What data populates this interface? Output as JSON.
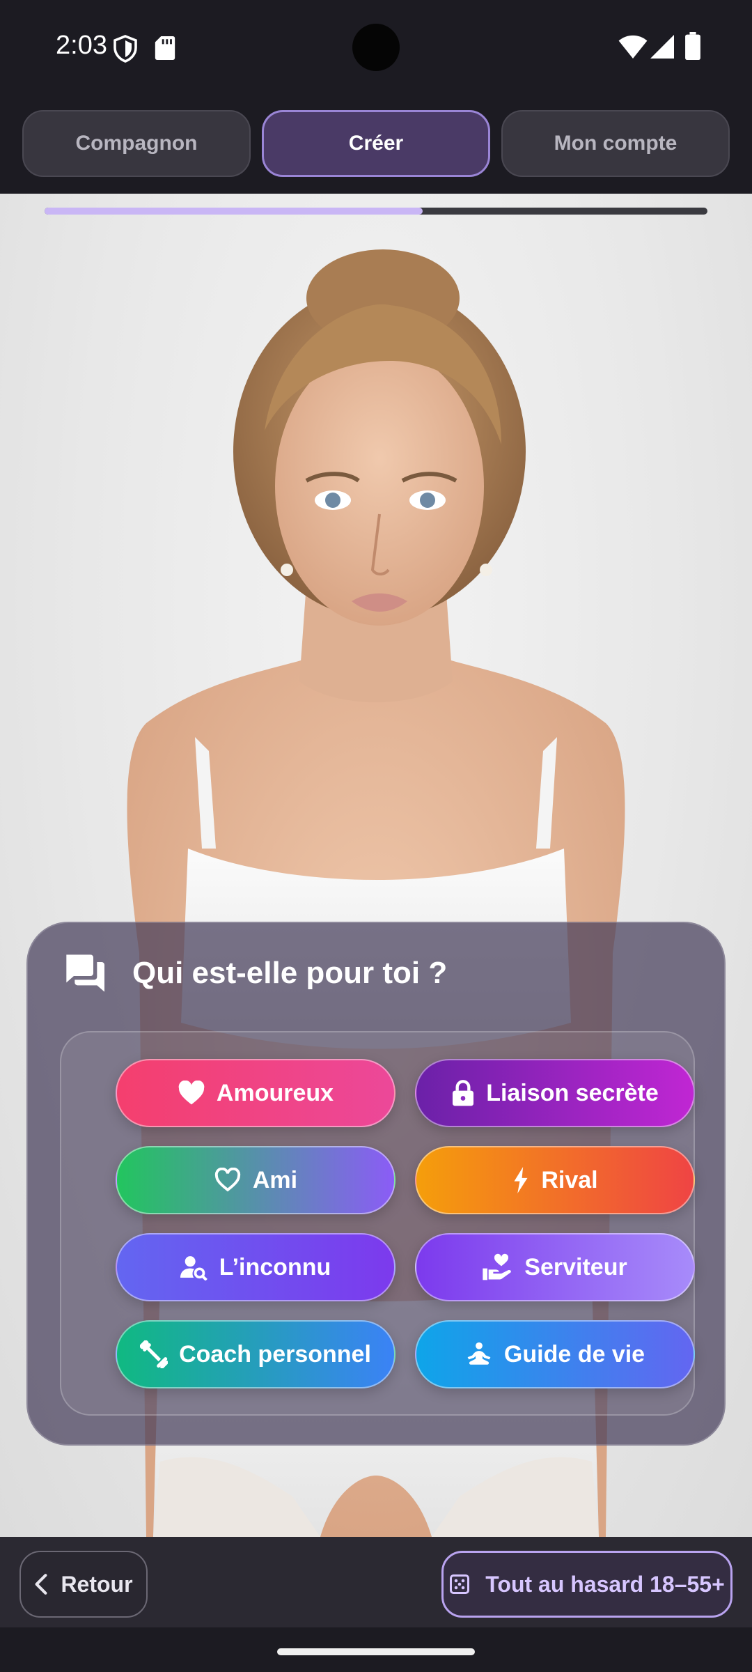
{
  "status_bar": {
    "time": "2:03",
    "icons": [
      "shield-icon",
      "sd-card-icon",
      "wifi-icon",
      "signal-icon",
      "battery-icon"
    ]
  },
  "tabs": [
    {
      "label": "Compagnon",
      "active": false
    },
    {
      "label": "Créer",
      "active": true
    },
    {
      "label": "Mon compte",
      "active": false
    }
  ],
  "progress": {
    "fraction": 0.57
  },
  "card": {
    "icon": "chat-bubbles-icon",
    "title": "Qui est-elle pour toi ?",
    "options": [
      {
        "label": "Amoureux",
        "icon": "heart-icon"
      },
      {
        "label": "Liaison secrète",
        "icon": "lock-icon"
      },
      {
        "label": "Ami",
        "icon": "heart-outline-icon"
      },
      {
        "label": "Rival",
        "icon": "lightning-icon"
      },
      {
        "label": "L’inconnu",
        "icon": "person-search-icon"
      },
      {
        "label": "Serviteur",
        "icon": "hand-heart-icon"
      },
      {
        "label": "Coach personnel",
        "icon": "dumbbell-icon"
      },
      {
        "label": "Guide de vie",
        "icon": "meditation-icon"
      }
    ]
  },
  "bottom": {
    "back_label": "Retour",
    "random_label": "Tout au hasard 18–55+"
  },
  "colors": {
    "accent": "#b9a3ef",
    "background": "#1c1b22"
  }
}
